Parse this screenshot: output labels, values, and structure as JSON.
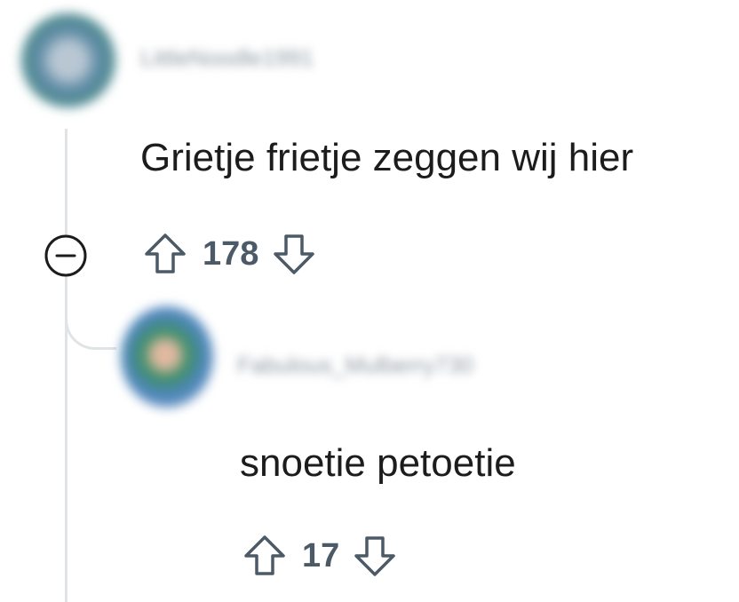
{
  "comment": {
    "username": "LittleNoodle1991",
    "text": "Grietje frietje zeggen wij hier",
    "score": "178",
    "collapse_icon": "minus-circle-icon",
    "upvote_icon": "arrow-up-icon",
    "downvote_icon": "arrow-down-icon"
  },
  "reply": {
    "username": "Fabulous_Mulberry730",
    "text": "snoetie petoetie",
    "score": "17",
    "upvote_icon": "arrow-up-icon",
    "downvote_icon": "arrow-down-icon"
  },
  "colors": {
    "thread_line": "#e1e4e6",
    "text": "#1c1c1c",
    "vote_count": "#4b5a66",
    "icon": "#4b5a66"
  }
}
